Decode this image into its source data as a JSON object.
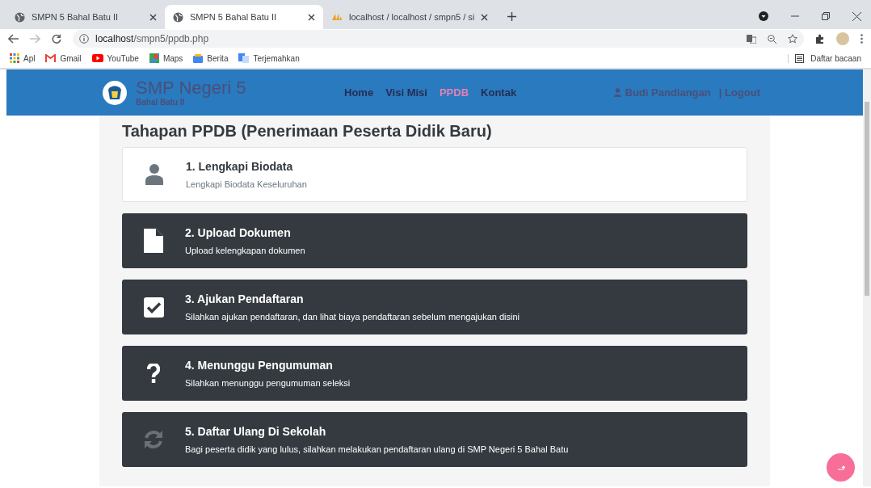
{
  "browser": {
    "tabs": [
      {
        "title": "SMPN 5 Bahal Batu II",
        "selected": false
      },
      {
        "title": "SMPN 5 Bahal Batu II",
        "selected": true
      },
      {
        "title": "localhost / localhost / smpn5 / si",
        "selected": false
      }
    ],
    "address": {
      "host": "localhost",
      "path": "/smpn5/ppdb.php"
    },
    "bookmarks": [
      "Apl",
      "Gmail",
      "YouTube",
      "Maps",
      "Berita",
      "Terjemahkan"
    ],
    "reading_list": "Daftar bacaan"
  },
  "navbar": {
    "title": "SMP Negeri 5",
    "subtitle": "Bahal Batu II",
    "links": [
      {
        "label": "Home",
        "selected": false
      },
      {
        "label": "Visi Misi",
        "selected": false
      },
      {
        "label": "PPDB",
        "selected": true
      },
      {
        "label": "Kontak",
        "selected": false
      }
    ],
    "user": "Budi Pandiangan",
    "logout": "| Logout"
  },
  "heading": "Tahapan PPDB (Penerimaan Peserta Didik Baru)",
  "steps": [
    {
      "title": "1. Lengkapi Biodata",
      "description": "Lengkapi Biodata Keseluruhan",
      "active": true
    },
    {
      "title": "2. Upload Dokumen",
      "description": "Upload kelengkapan dokumen",
      "active": false
    },
    {
      "title": "3. Ajukan Pendaftaran",
      "description": "Silahkan ajukan pendaftaran, dan lihat biaya pendaftaran sebelum mengajukan disini",
      "active": false
    },
    {
      "title": "4. Menunggu Pengumuman",
      "description": "Silahkan menunggu pengumuman seleksi",
      "active": false
    },
    {
      "title": "5. Daftar Ulang Di Sekolah",
      "description": "Bagi peserta didik yang lulus, silahkan melakukan pendaftaran ulang di SMP Negeri 5 Bahal Batu",
      "active": false
    }
  ]
}
